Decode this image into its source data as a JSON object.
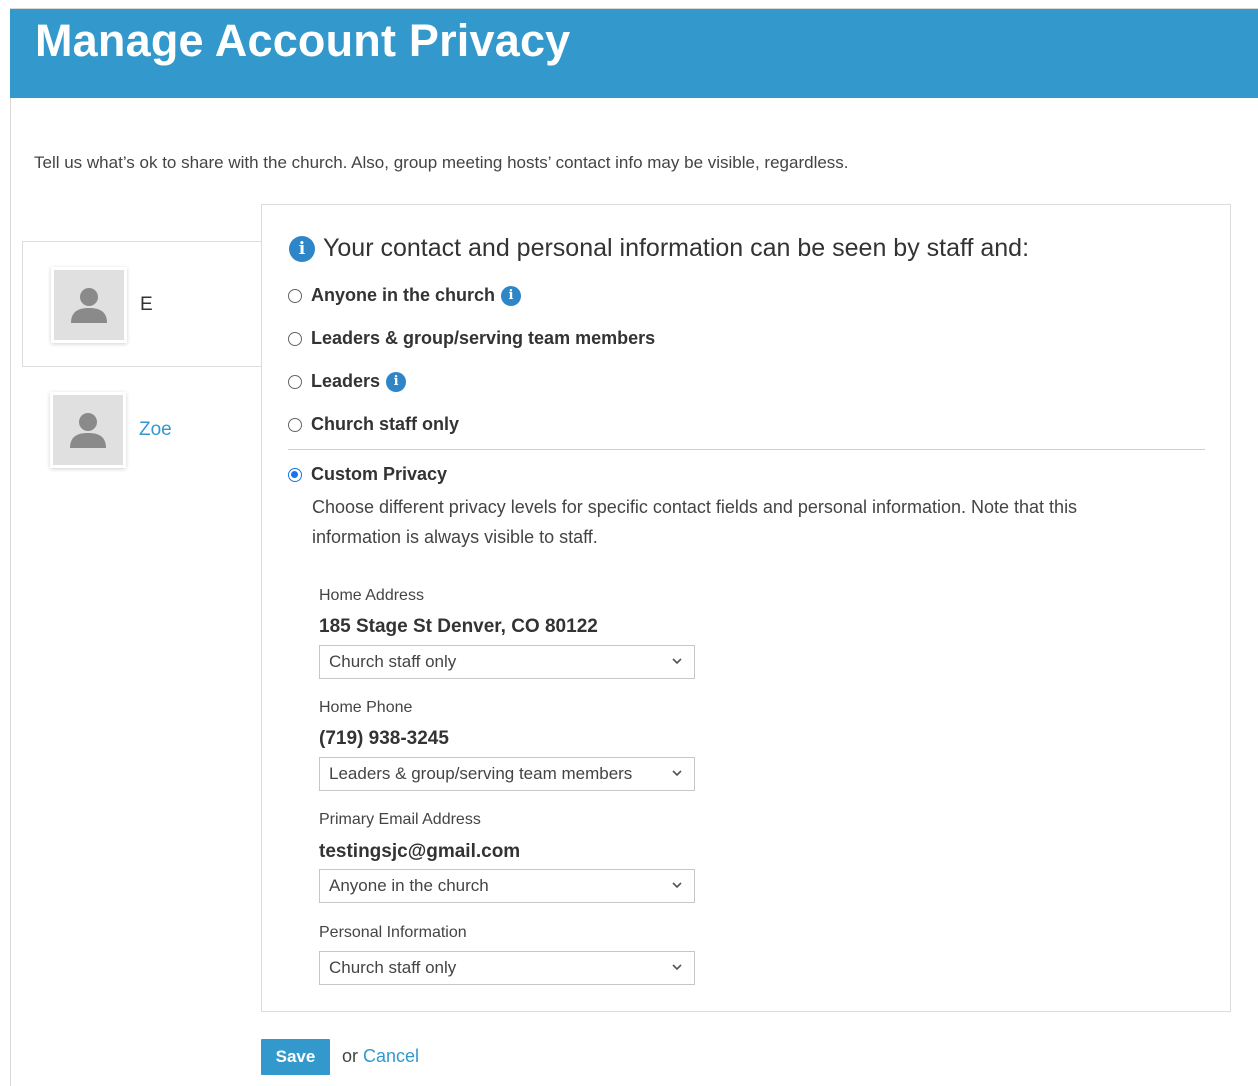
{
  "header": {
    "title": "Manage Account Privacy"
  },
  "intro": "Tell us what’s ok to share with the church. Also, group meeting hosts’ contact info may be visible, regardless.",
  "people": [
    {
      "name": "E",
      "active": true
    },
    {
      "name": "Zoe",
      "active": false
    }
  ],
  "panel": {
    "title": "Your contact and personal information can be seen by staff and:",
    "options": [
      {
        "label": "Anyone in the church",
        "info": true,
        "checked": false
      },
      {
        "label": "Leaders & group/serving team members",
        "info": false,
        "checked": false
      },
      {
        "label": "Leaders",
        "info": true,
        "checked": false
      },
      {
        "label": "Church staff only",
        "info": false,
        "checked": false
      },
      {
        "label": "Custom Privacy",
        "info": false,
        "checked": true
      }
    ],
    "custom_description": "Choose different privacy levels for specific contact fields and personal information. Note that this information is always visible to staff.",
    "fields": [
      {
        "label": "Home Address",
        "value": "185 Stage St Denver, CO 80122",
        "selected": "Church staff only"
      },
      {
        "label": "Home Phone",
        "value": "(719) 938-3245",
        "selected": "Leaders & group/serving team members"
      },
      {
        "label": "Primary Email Address",
        "value": "testingsjc@gmail.com",
        "selected": "Anyone in the church"
      },
      {
        "label": "Personal Information",
        "value": "",
        "selected": "Church staff only"
      }
    ]
  },
  "actions": {
    "save_label": "Save",
    "or_text": "or",
    "cancel_label": "Cancel"
  },
  "colors": {
    "header": "#3399cc",
    "link": "#3399cc",
    "radio_checked": "#1a73e8",
    "info_icon": "#2e86c8"
  },
  "icons": {
    "info": "info-icon",
    "avatar": "person-silhouette-icon",
    "dropdown": "chevron-down-icon"
  }
}
